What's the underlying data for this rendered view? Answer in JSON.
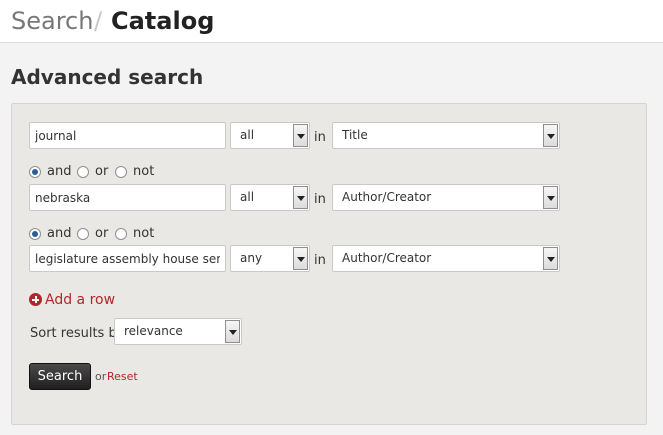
{
  "breadcrumb": {
    "search": "Search",
    "separator": "/",
    "catalog": "Catalog"
  },
  "page_title": "Advanced search",
  "rows": [
    {
      "query": "journal",
      "match": "all",
      "in": "in",
      "field": "Title"
    },
    {
      "operator": {
        "and": "and",
        "or": "or",
        "not": "not",
        "selected": "and"
      },
      "query": "nebraska",
      "match": "all",
      "in": "in",
      "field": "Author/Creator"
    },
    {
      "operator": {
        "and": "and",
        "or": "or",
        "not": "not",
        "selected": "and"
      },
      "query": "legislature assembly house senat",
      "match": "any",
      "in": "in",
      "field": "Author/Creator"
    }
  ],
  "add_row": {
    "label": "Add a row",
    "icon": "plus-circle-icon"
  },
  "sort": {
    "label": "Sort results by",
    "value": "relevance"
  },
  "actions": {
    "search_label": "Search",
    "or_text": "or",
    "reset_label": "Reset"
  },
  "colors": {
    "accent": "#b1262a",
    "panel": "#eae8e4",
    "button": "#2b2b2b"
  }
}
